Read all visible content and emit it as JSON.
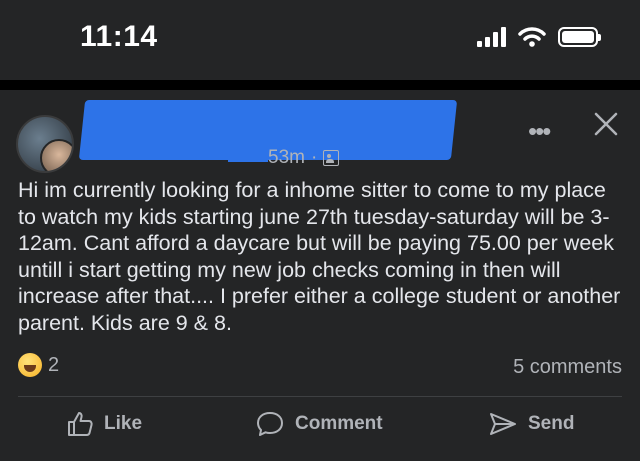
{
  "status_bar": {
    "time": "11:14"
  },
  "post": {
    "time_ago": "53m",
    "separator": "·",
    "body": "Hi im currently looking for a inhome sitter to come to my place to watch my kids starting june 27th tuesday-saturday will be 3-12am. Cant afford a daycare but will be paying 75.00 per week untill i start getting my new job checks coming in then will increase after that.... I prefer either a college student or another parent. Kids are 9 & 8.",
    "reaction_count": "2",
    "comments_count": "5 comments"
  },
  "actions": {
    "like": "Like",
    "comment": "Comment",
    "send": "Send"
  },
  "colors": {
    "background": "#242526",
    "text": "#e4e6eb",
    "muted": "#b0b3b8",
    "redaction": "#2d73e8"
  }
}
